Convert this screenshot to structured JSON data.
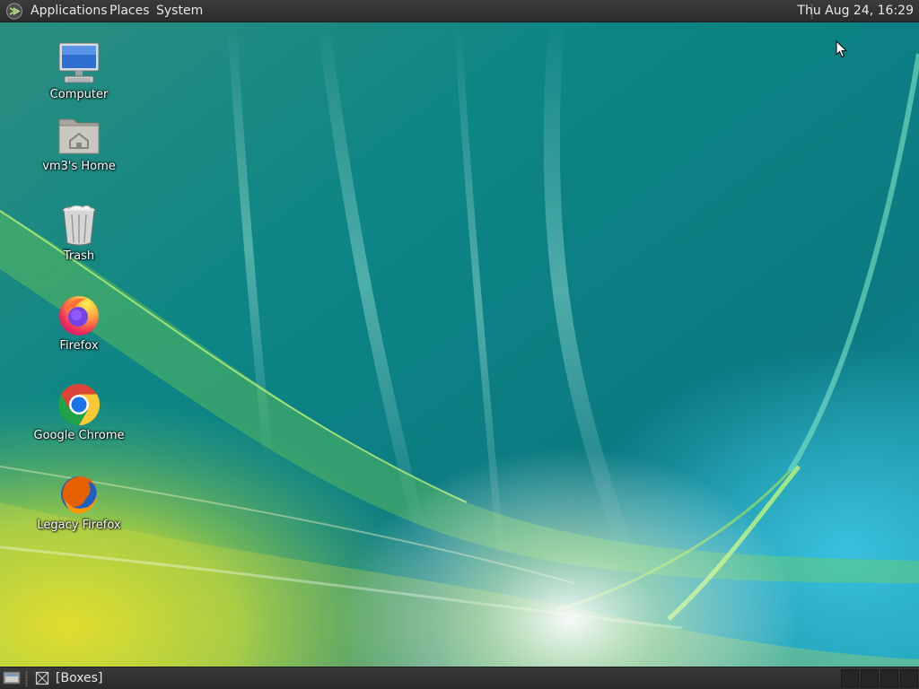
{
  "top_panel": {
    "menus": {
      "applications": "Applications",
      "places": "Places",
      "system": "System"
    },
    "clock": "Thu Aug 24, 16:29"
  },
  "desktop": {
    "icons": [
      {
        "label": "Computer",
        "icon": "computer-icon"
      },
      {
        "label": "vm3's Home",
        "icon": "home-folder-icon"
      },
      {
        "label": "Trash",
        "icon": "trash-icon"
      },
      {
        "label": "Firefox",
        "icon": "firefox-icon"
      },
      {
        "label": "Google Chrome",
        "icon": "chrome-icon"
      },
      {
        "label": "Legacy Firefox",
        "icon": "legacy-firefox-icon"
      }
    ]
  },
  "bottom_panel": {
    "window_button": "[Boxes]"
  },
  "colors": {
    "panel": "#2f2f2f",
    "wallpaper_teal": "#0f7f86",
    "wallpaper_green": "#9cd83a",
    "wallpaper_yellow": "#d9d422"
  }
}
